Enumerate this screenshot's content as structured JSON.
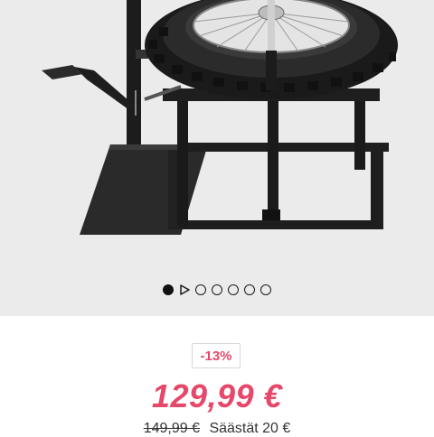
{
  "gallery": {
    "image_alt": "Motorcycle tyre changer stand with mounted wheel",
    "slide_count": 7,
    "active_index": 0
  },
  "pricing": {
    "discount_badge": "-13%",
    "current_price": "129,99 €",
    "old_price": "149,99 €",
    "savings_text": "Säästät 20 €"
  },
  "colors": {
    "accent": "#e5486a",
    "background": "#ebebeb"
  }
}
